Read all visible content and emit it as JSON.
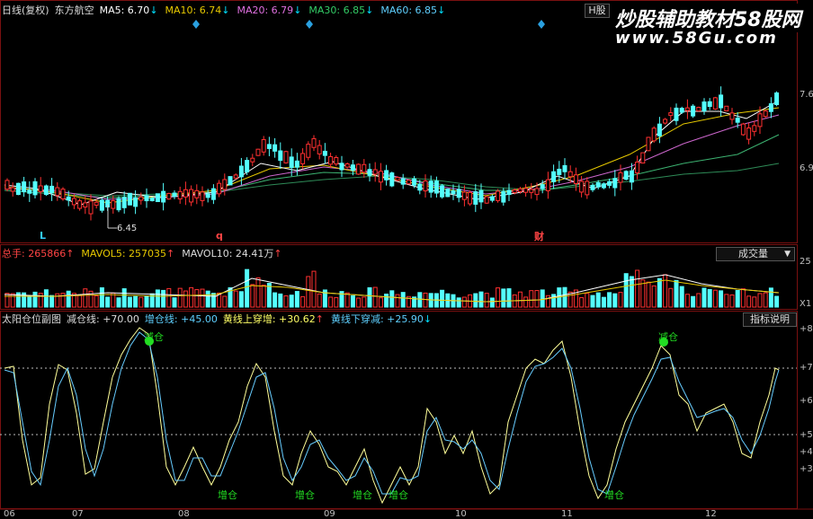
{
  "price_panel": {
    "title": "日线(复权)",
    "stock": "东方航空",
    "ma5": "MA5: 6.70",
    "ma10": "MA10: 6.74",
    "ma20": "MA20: 6.79",
    "ma30": "MA30: 6.85",
    "ma60": "MA60: 6.85",
    "h_button": "H股",
    "low_label": "6.45",
    "mark_L": "L",
    "mark_q": "q",
    "mark_cai": "财",
    "tick_76": "7.6",
    "tick_69": "6.9"
  },
  "volume_panel": {
    "total": "总手: 265866",
    "mavol5": "MAVOL5: 257035",
    "mavol10": "MAVOL10: 24.41万",
    "dropdown": "成交量",
    "tick_25": "25",
    "tick_x1": "X1"
  },
  "indicator_panel": {
    "name": "太阳仓位副图",
    "reduce": "减仓线: +70.00",
    "add": "增仓线: +45.00",
    "yellow_up": "黄线上穿增: +30.62",
    "yellow_down": "黄线下穿减: +25.90",
    "help_button": "指标说明",
    "sig_reduce1": "减仓",
    "sig_reduce2": "减仓",
    "sig_add1": "增仓",
    "sig_add2": "增仓",
    "sig_add3": "增仓",
    "sig_add4": "增仓",
    "sig_add5": "增仓",
    "ticks": [
      "+8",
      "+7",
      "+6",
      "+5",
      "+4",
      "+3"
    ]
  },
  "xaxis": [
    "06",
    "07",
    "08",
    "09",
    "10",
    "11",
    "12"
  ],
  "watermark": {
    "line1": "炒股辅助教材58股网",
    "line2": "www.58Gu.com"
  }
}
